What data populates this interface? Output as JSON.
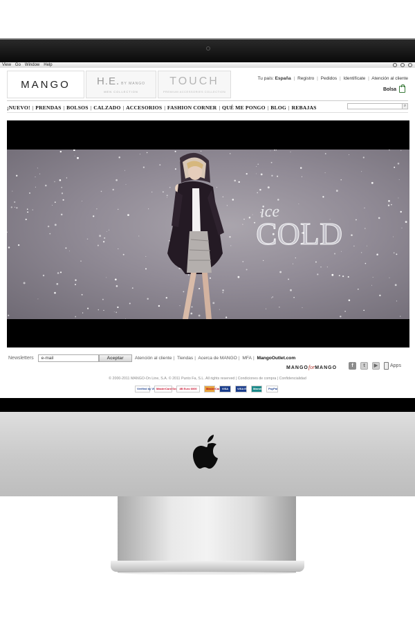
{
  "os_menubar": {
    "items": [
      "View",
      "Go",
      "Window",
      "Help"
    ]
  },
  "header": {
    "logos": {
      "mango": "MANGO",
      "he_main": "H.E.",
      "he_by": "BY MANGO",
      "he_sub": "MEN COLLECTION",
      "touch_main": "TOUCH",
      "touch_sub": "PREMIUM ACCESSORIES COLLECTION"
    },
    "top_links": {
      "country_label": "Tu país:",
      "country": "España",
      "items": [
        "Registro",
        "Pedidos",
        "Identifícate",
        "Atención al cliente"
      ]
    },
    "bag_label": "Bolsa"
  },
  "nav": {
    "items": [
      "¡NUEVO!",
      "PRENDAS",
      "BOLSOS",
      "CALZADO",
      "ACCESORIOS",
      "FASHION CORNER",
      "QUÉ ME PONGO",
      "BLOG",
      "REBAJAS"
    ]
  },
  "search": {
    "placeholder": ""
  },
  "hero": {
    "ice": "ice",
    "cold": "COLD"
  },
  "footer": {
    "newsletter_label": "Newsletters",
    "email_value": "e-mail",
    "accept_button": "Aceptar",
    "links": [
      "Atención al cliente",
      "Tiendas",
      "Acerca de MANGO",
      "MFA"
    ],
    "outlet_link": "MangoOutlet.com",
    "mango_for_mango": {
      "pre": "MANGO",
      "mid": "for",
      "post": "MANGO"
    },
    "apps_label": "Apps",
    "copyright": "© 2000-2011 MANGO-On Line, S.A. © 2011 Punto Fa, S.L. All rights reserved | Condiciones de compra | Confidencialidad",
    "payment_methods": [
      "Verified by VISA",
      "MasterCard SecureCode",
      "4B Euro 6000",
      "MasterCard",
      "VISA",
      "VISA Electron",
      "Maestro",
      "PayPal"
    ]
  }
}
